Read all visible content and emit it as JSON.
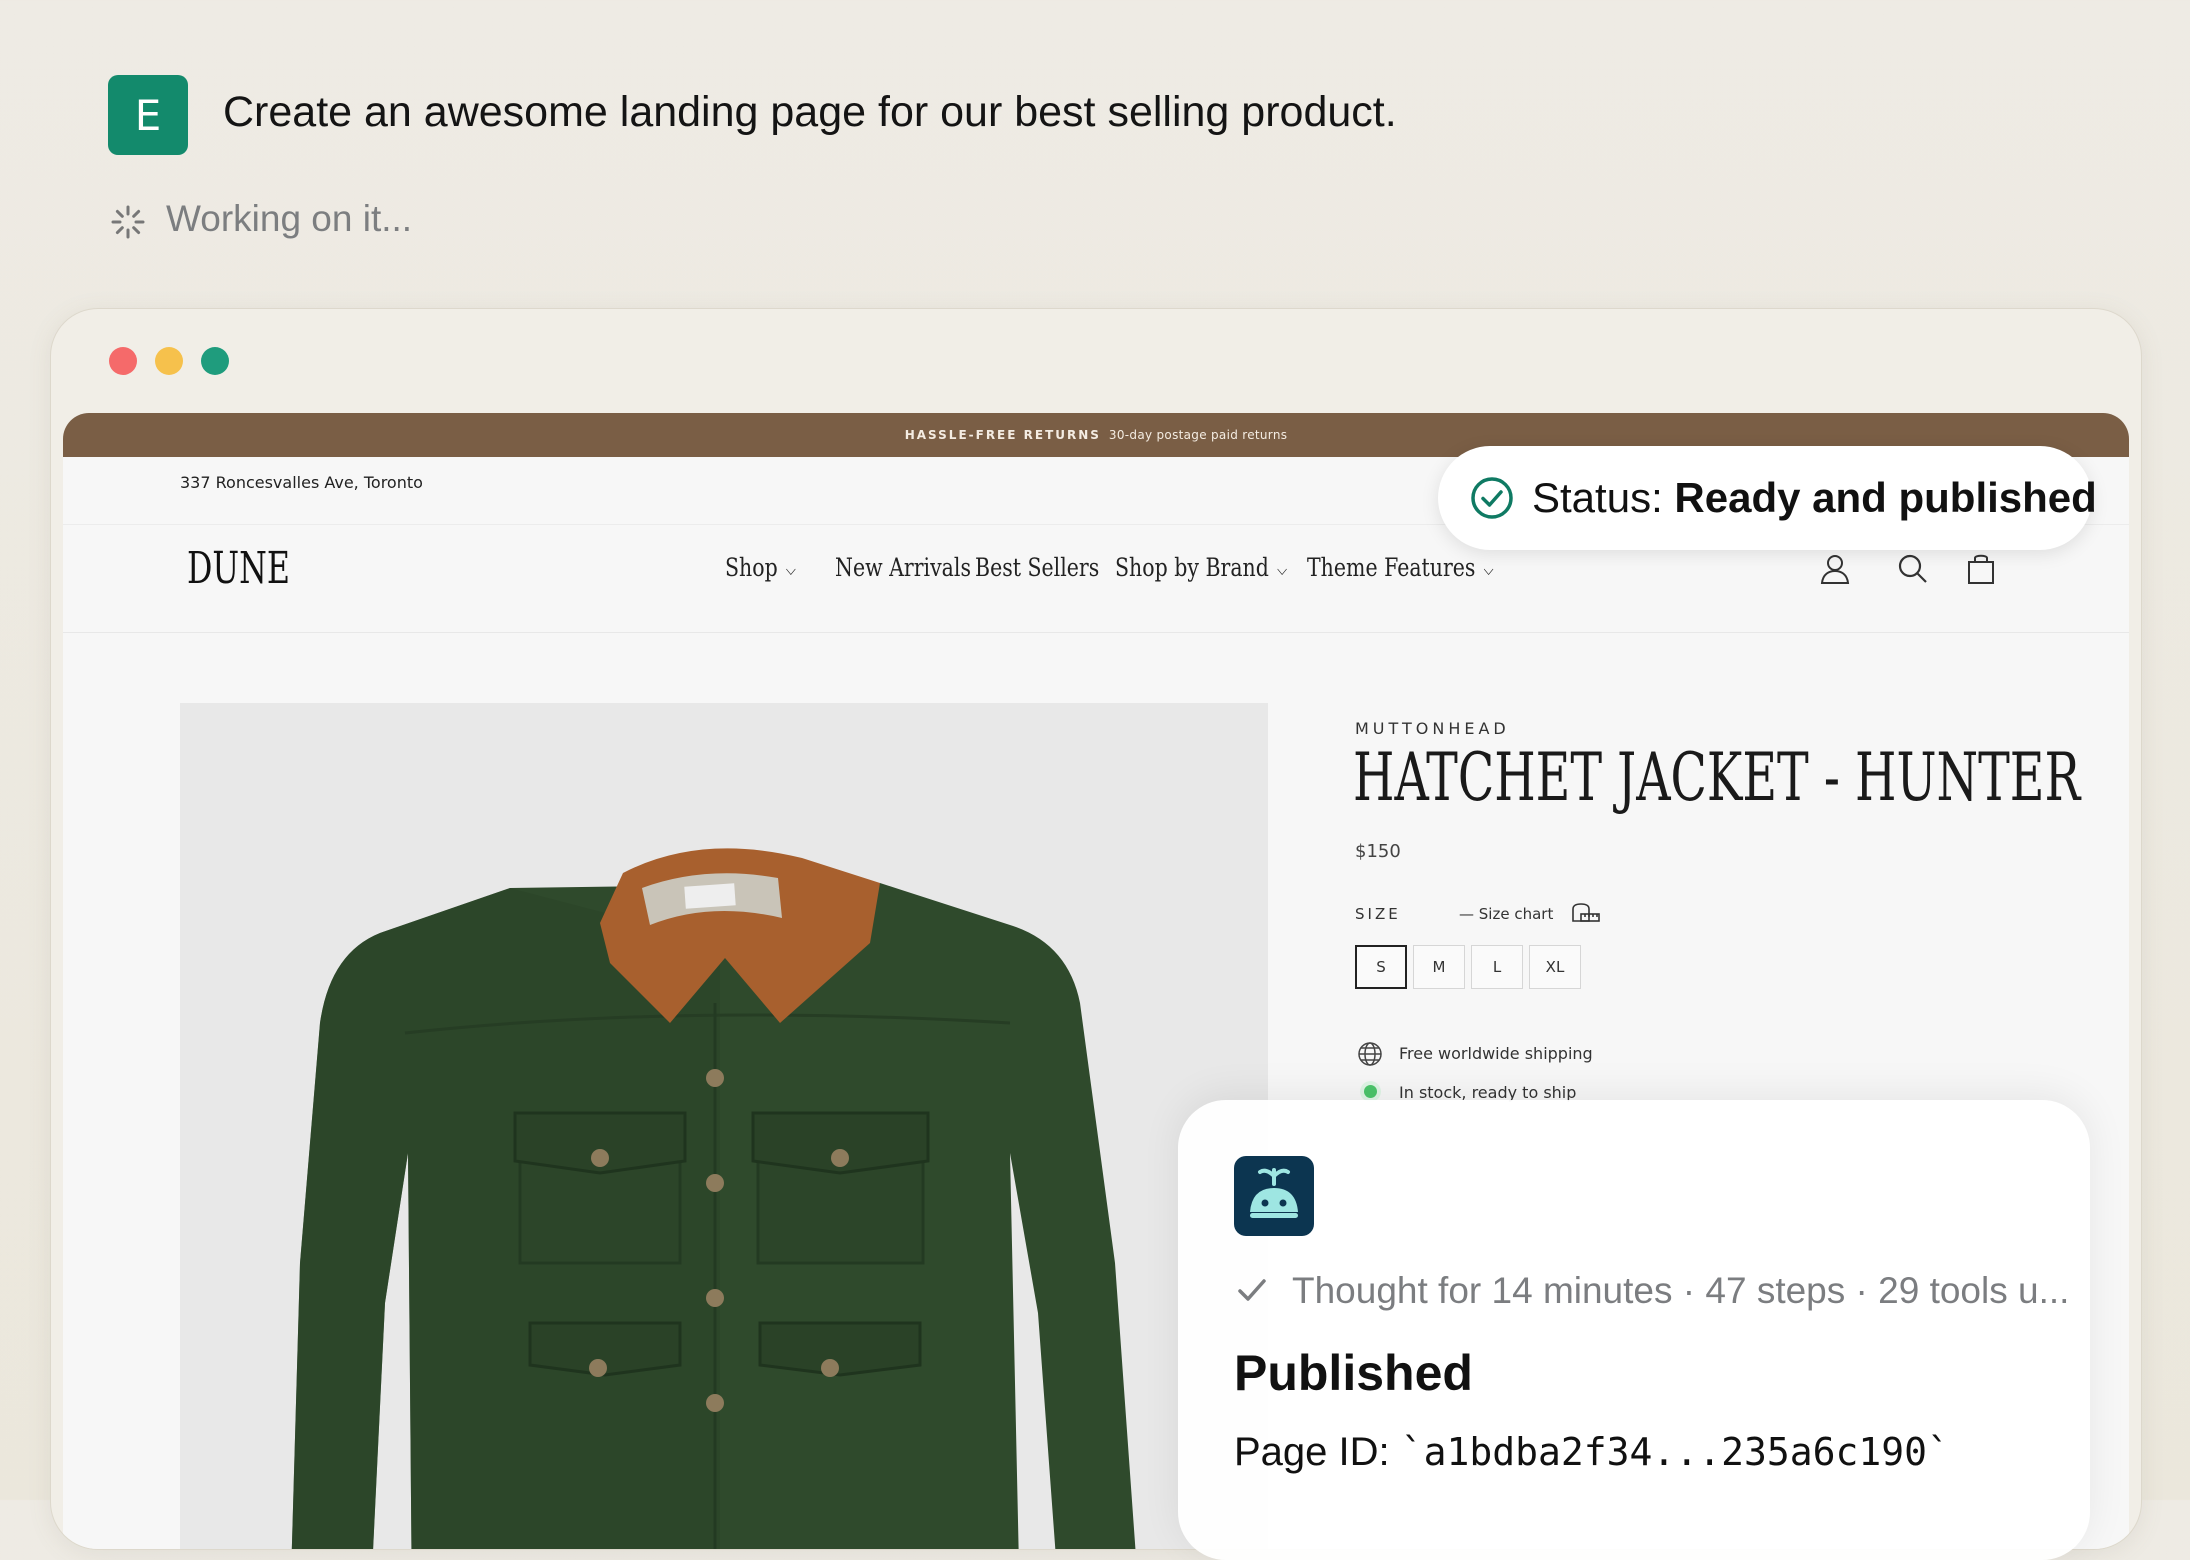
{
  "prompt": {
    "avatar_letter": "E",
    "text": "Create an awesome landing page for our best selling product.",
    "working": "Working on it..."
  },
  "store": {
    "announcement": {
      "strong": "HASSLE-FREE RETURNS",
      "text": "30-day postage paid returns"
    },
    "address": "337 Roncesvalles Ave, Toronto",
    "logo": "DUNE",
    "nav": [
      {
        "label": "Shop",
        "dropdown": "⌵"
      },
      {
        "label": "New Arrivals"
      },
      {
        "label": "Best Sellers"
      },
      {
        "label": "Shop by Brand",
        "dropdown": "⌵"
      },
      {
        "label": "Theme Features",
        "dropdown": "⌵"
      }
    ],
    "header_icons": [
      "account-icon",
      "search-icon",
      "cart-icon"
    ],
    "product": {
      "vendor": "MUTTONHEAD",
      "title": "HATCHET JACKET - HUNTER",
      "price": "$150",
      "size_label": "SIZE",
      "size_chart": "— Size chart",
      "sizes": [
        "S",
        "M",
        "L",
        "XL"
      ],
      "selected_size": "S",
      "features": {
        "shipping": "Free worldwide shipping",
        "stock": "In stock, ready to ship"
      }
    }
  },
  "status": {
    "label": "Status:",
    "value": "Ready and published"
  },
  "agent": {
    "thought": "Thought for 14 minutes · 47 steps · 29 tools u...",
    "published": "Published",
    "page_id_label": "Page ID:",
    "page_id_value": "`a1bdba2f34...235a6c190`"
  },
  "colors": {
    "avatar_bg": "#138a6c",
    "announcement_bg": "#7a5e45",
    "status_check": "#0f7a63",
    "agent_logo_bg": "#0c3550",
    "stock_dot": "#4bc56a",
    "jacket_green": "#2f4a2c",
    "collar_brown": "#a8602e"
  }
}
